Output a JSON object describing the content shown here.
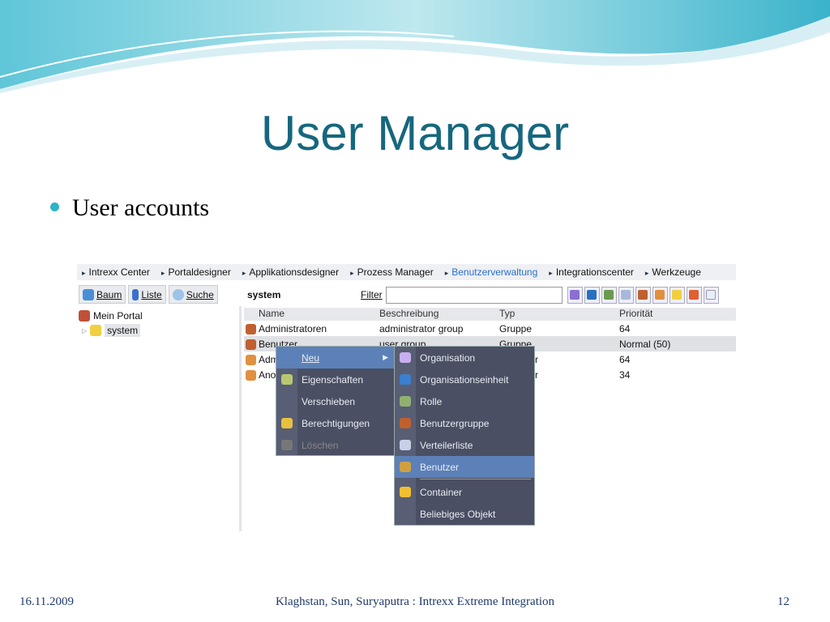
{
  "slide": {
    "title": "User Manager",
    "bullet": "User accounts",
    "footer_date": "16.11.2009",
    "footer_text": "Klaghstan, Sun, Suryaputra : Intrexx Extreme Integration",
    "page_number": "12"
  },
  "menubar": [
    "Intrexx Center",
    "Portaldesigner",
    "Applikationsdesigner",
    "Prozess Manager",
    "Benutzerverwaltung",
    "Integrationscenter",
    "Werkzeuge"
  ],
  "left_toolbar": {
    "baum": "Baum",
    "liste": "Liste",
    "suche": "Suche"
  },
  "tree": {
    "root": "Mein Portal",
    "child": "system"
  },
  "right_toolbar": {
    "path": "system",
    "filter_label": "Filter",
    "filter_value": ""
  },
  "table": {
    "headers": [
      "Name",
      "Beschreibung",
      "Typ",
      "Priorität"
    ],
    "rows": [
      [
        "Administratoren",
        "administrator group",
        "Gruppe",
        "64"
      ],
      [
        "Benutzer",
        "user group",
        "Gruppe",
        "Normal (50)"
      ],
      [
        "Administrator",
        "",
        "Benutzer",
        "64"
      ],
      [
        "Anonymous",
        "",
        "Benutzer",
        "34"
      ]
    ]
  },
  "context_menu": [
    "Neu",
    "Eigenschaften",
    "Verschieben",
    "Berechtigungen",
    "Löschen"
  ],
  "submenu": [
    "Organisation",
    "Organisationseinheit",
    "Rolle",
    "Benutzergruppe",
    "Verteilerliste",
    "Benutzer",
    "Container",
    "Beliebiges Objekt"
  ],
  "colors": {
    "title": "#16677e",
    "accent": "#2cb4c9",
    "menu_bg": "#4a4f63",
    "menu_highlight": "#5c80b8"
  }
}
